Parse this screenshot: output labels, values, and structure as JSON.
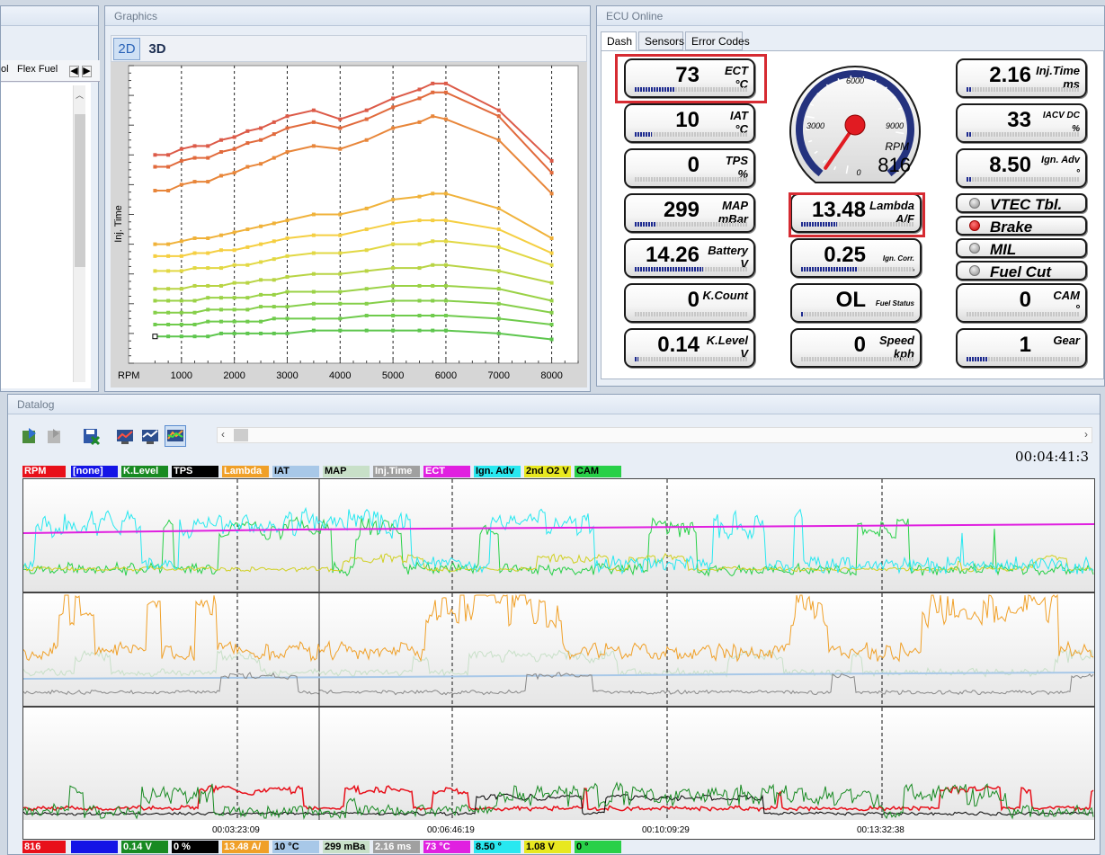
{
  "left_window": {
    "tab1": "ol",
    "tab2": "Flex Fuel"
  },
  "graphics": {
    "title": "Graphics",
    "btn_2d": "2D",
    "btn_3d": "3D"
  },
  "chart_data": {
    "type": "line",
    "title": "",
    "ylabel": "Inj. Time",
    "xlabel": "RPM",
    "x": [
      500,
      750,
      1000,
      1250,
      1500,
      1750,
      2000,
      2250,
      2500,
      2750,
      3000,
      3500,
      4000,
      4500,
      5000,
      5500,
      5750,
      6000,
      7000,
      8000
    ],
    "x_ticks": [
      1000,
      2000,
      3000,
      4000,
      5000,
      6000,
      7000,
      8000
    ],
    "xlim": [
      0,
      8500
    ],
    "ylim": [
      0,
      100
    ],
    "series": [
      {
        "values": [
          70,
          70,
          72,
          73,
          73,
          75,
          76,
          78,
          79,
          81,
          83,
          85,
          82,
          85,
          89,
          92,
          94,
          94,
          85,
          68
        ],
        "color": "#dc5a48"
      },
      {
        "values": [
          66,
          66,
          68,
          69,
          69,
          71,
          72,
          74,
          75,
          77,
          79,
          81,
          79,
          82,
          86,
          89,
          91,
          91,
          83,
          64
        ],
        "color": "#e16a3c"
      },
      {
        "values": [
          58,
          58,
          60,
          61,
          61,
          63,
          64,
          66,
          67,
          69,
          71,
          73,
          72,
          75,
          79,
          81,
          83,
          82,
          75,
          57
        ],
        "color": "#e8863a"
      },
      {
        "values": [
          40,
          40,
          41,
          42,
          42,
          43,
          44,
          45,
          46,
          47,
          48,
          50,
          50,
          52,
          55,
          56,
          57,
          57,
          52,
          42
        ],
        "color": "#f0b23a"
      },
      {
        "values": [
          36,
          36,
          36,
          37,
          37,
          38,
          38,
          39,
          40,
          41,
          42,
          43,
          43,
          45,
          47,
          48,
          48,
          48,
          45,
          37
        ],
        "color": "#f5cf42"
      },
      {
        "values": [
          31,
          31,
          31,
          32,
          32,
          32,
          33,
          33,
          34,
          35,
          36,
          37,
          37,
          38,
          40,
          40,
          41,
          41,
          39,
          33
        ],
        "color": "#e2d844"
      },
      {
        "values": [
          25,
          25,
          25,
          26,
          26,
          26,
          27,
          27,
          28,
          28,
          29,
          30,
          30,
          31,
          32,
          32,
          33,
          33,
          31,
          27
        ],
        "color": "#b8d444"
      },
      {
        "values": [
          21,
          21,
          21,
          21,
          22,
          22,
          22,
          22,
          23,
          23,
          24,
          24,
          24,
          25,
          26,
          26,
          26,
          26,
          25,
          21
        ],
        "color": "#9ad246"
      },
      {
        "values": [
          17,
          17,
          17,
          17,
          18,
          18,
          18,
          18,
          19,
          19,
          19,
          20,
          20,
          20,
          21,
          21,
          21,
          21,
          20,
          17
        ],
        "color": "#86cf4a"
      },
      {
        "values": [
          13,
          13,
          13,
          13,
          14,
          14,
          14,
          14,
          14,
          15,
          15,
          15,
          15,
          16,
          16,
          16,
          16,
          16,
          15,
          13
        ],
        "color": "#6fcb4c"
      },
      {
        "values": [
          9,
          9,
          9,
          9,
          9,
          10,
          10,
          10,
          10,
          10,
          10,
          11,
          11,
          11,
          11,
          11,
          11,
          11,
          10,
          8
        ],
        "color": "#5ec64e"
      }
    ]
  },
  "ecu": {
    "title": "ECU Online",
    "tabs": [
      "Dash",
      "Sensors",
      "Error Codes"
    ],
    "gauges": {
      "ect": {
        "value": "73",
        "label1": "ECT",
        "label2": "°C",
        "fill": 0.35
      },
      "iat": {
        "value": "10",
        "label1": "IAT",
        "label2": "°C",
        "fill": 0.15
      },
      "tps": {
        "value": "0",
        "label1": "TPS",
        "label2": "%",
        "fill": 0
      },
      "map": {
        "value": "299",
        "label1": "MAP",
        "label2": "mBar",
        "fill": 0.18
      },
      "battery": {
        "value": "14.26",
        "label1": "Battery",
        "label2": "V",
        "fill": 0.6
      },
      "kcount": {
        "value": "0",
        "label1": "K.Count",
        "label2": "",
        "fill": 0
      },
      "klevel": {
        "value": "0.14",
        "label1": "K.Level",
        "label2": "V",
        "fill": 0.03
      },
      "lambda": {
        "value": "13.48",
        "label1": "Lambda",
        "label2": "A/F",
        "fill": 0.32
      },
      "igncorr": {
        "value": "0.25",
        "label1": "Ign. Corr.",
        "label2": "°",
        "fill": 0.5
      },
      "fuelstatus": {
        "value": "OL",
        "label1": "Fuel Status",
        "label2": "",
        "fill": 0.02
      },
      "speed": {
        "value": "0",
        "label1": "Speed",
        "label2": "kph",
        "fill": 0
      },
      "injtime": {
        "value": "2.16",
        "label1": "Inj.Time",
        "label2": "ms",
        "fill": 0.05
      },
      "iacv": {
        "value": "33",
        "label1": "IACV DC",
        "label2": "%",
        "fill": 0.05
      },
      "ignadv": {
        "value": "8.50",
        "label1": "Ign. Adv",
        "label2": "°",
        "fill": 0.05
      },
      "cam": {
        "value": "0",
        "label1": "CAM",
        "label2": "°",
        "fill": 0
      },
      "gear": {
        "value": "1",
        "label1": "Gear",
        "label2": "",
        "fill": 0.18
      }
    },
    "rpm_gauge": {
      "label": "RPM",
      "value": "816",
      "tick_6000": "6000",
      "tick_3000": "3000",
      "tick_9000": "9000",
      "tick_0": "0",
      "rpm": 816,
      "max": 9000
    },
    "indicators": [
      {
        "label": "VTEC Tbl.",
        "on": false
      },
      {
        "label": "Brake",
        "on": true
      },
      {
        "label": "MIL",
        "on": false
      },
      {
        "label": "Fuel Cut",
        "on": false
      }
    ]
  },
  "datalog": {
    "title": "Datalog",
    "timestamp": "00:04:41:3",
    "legend": [
      {
        "label": "RPM",
        "bg": "#e8101a",
        "fg": "#ffffff"
      },
      {
        "label": "[none]",
        "bg": "#1414e6",
        "fg": "#ffffff"
      },
      {
        "label": "K.Level",
        "bg": "#188a22",
        "fg": "#ffffff"
      },
      {
        "label": "TPS",
        "bg": "#000000",
        "fg": "#ffffff"
      },
      {
        "label": "Lambda",
        "bg": "#f0a028",
        "fg": "#ffffff"
      },
      {
        "label": "IAT",
        "bg": "#a8c8e8",
        "fg": "#000000"
      },
      {
        "label": "MAP",
        "bg": "#c8e0c8",
        "fg": "#000000"
      },
      {
        "label": "Inj.Time",
        "bg": "#a0a0a0",
        "fg": "#ffffff"
      },
      {
        "label": "ECT",
        "bg": "#e020e0",
        "fg": "#ffffff"
      },
      {
        "label": "Ign. Adv",
        "bg": "#28e8f0",
        "fg": "#000000"
      },
      {
        "label": "2nd O2 V",
        "bg": "#e8e820",
        "fg": "#000000"
      },
      {
        "label": "CAM",
        "bg": "#28d048",
        "fg": "#000000"
      }
    ],
    "values": [
      {
        "label": "816",
        "bg": "#e8101a",
        "fg": "#ffffff"
      },
      {
        "label": "",
        "bg": "#1414e6",
        "fg": "#ffffff"
      },
      {
        "label": "0.14 V",
        "bg": "#188a22",
        "fg": "#ffffff"
      },
      {
        "label": "0 %",
        "bg": "#000000",
        "fg": "#ffffff"
      },
      {
        "label": "13.48 A/",
        "bg": "#f0a028",
        "fg": "#ffffff"
      },
      {
        "label": "10 °C",
        "bg": "#a8c8e8",
        "fg": "#000000"
      },
      {
        "label": "299 mBa",
        "bg": "#c8e0c8",
        "fg": "#000000"
      },
      {
        "label": "2.16 ms",
        "bg": "#a0a0a0",
        "fg": "#ffffff"
      },
      {
        "label": "73 °C",
        "bg": "#e020e0",
        "fg": "#ffffff"
      },
      {
        "label": "8.50 °",
        "bg": "#28e8f0",
        "fg": "#000000"
      },
      {
        "label": "1.08 V",
        "bg": "#e8e820",
        "fg": "#000000"
      },
      {
        "label": "0 °",
        "bg": "#28d048",
        "fg": "#000000"
      }
    ],
    "time_ticks": [
      "00:03:23:09",
      "00:06:46:19",
      "00:10:09:29",
      "00:13:32:38"
    ]
  }
}
